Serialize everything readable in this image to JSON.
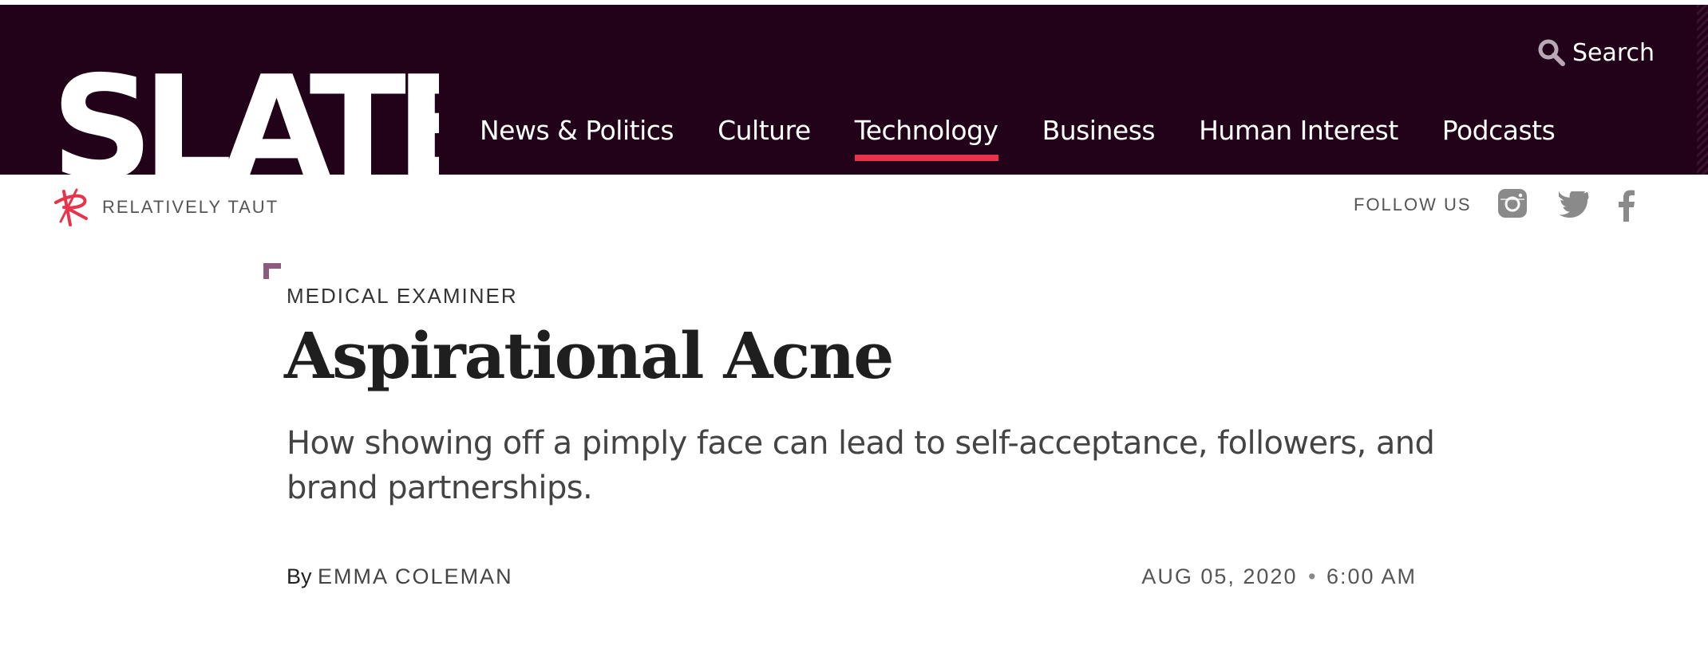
{
  "brand": {
    "logo_text": "SLATE",
    "colors": {
      "masthead": "#220218",
      "accent": "#e8334a",
      "corner_mark": "#8b5a7c"
    }
  },
  "nav": {
    "items": [
      {
        "label": "News & Politics",
        "active": false
      },
      {
        "label": "Culture",
        "active": false
      },
      {
        "label": "Technology",
        "active": true
      },
      {
        "label": "Business",
        "active": false
      },
      {
        "label": "Human Interest",
        "active": false
      },
      {
        "label": "Podcasts",
        "active": false
      }
    ],
    "search_label": "Search"
  },
  "subbar": {
    "section_label": "RELATIVELY TAUT",
    "follow_label": "FOLLOW US",
    "social_icons": [
      "instagram-icon",
      "twitter-icon",
      "facebook-icon"
    ]
  },
  "article": {
    "kicker": "MEDICAL EXAMINER",
    "headline": "Aspirational Acne",
    "dek": "How showing off a pimply face can lead to self-acceptance, followers, and brand partnerships.",
    "byline_prefix": "By",
    "author": "EMMA COLEMAN",
    "date": "AUG 05, 2020",
    "time": "6:00 AM"
  }
}
